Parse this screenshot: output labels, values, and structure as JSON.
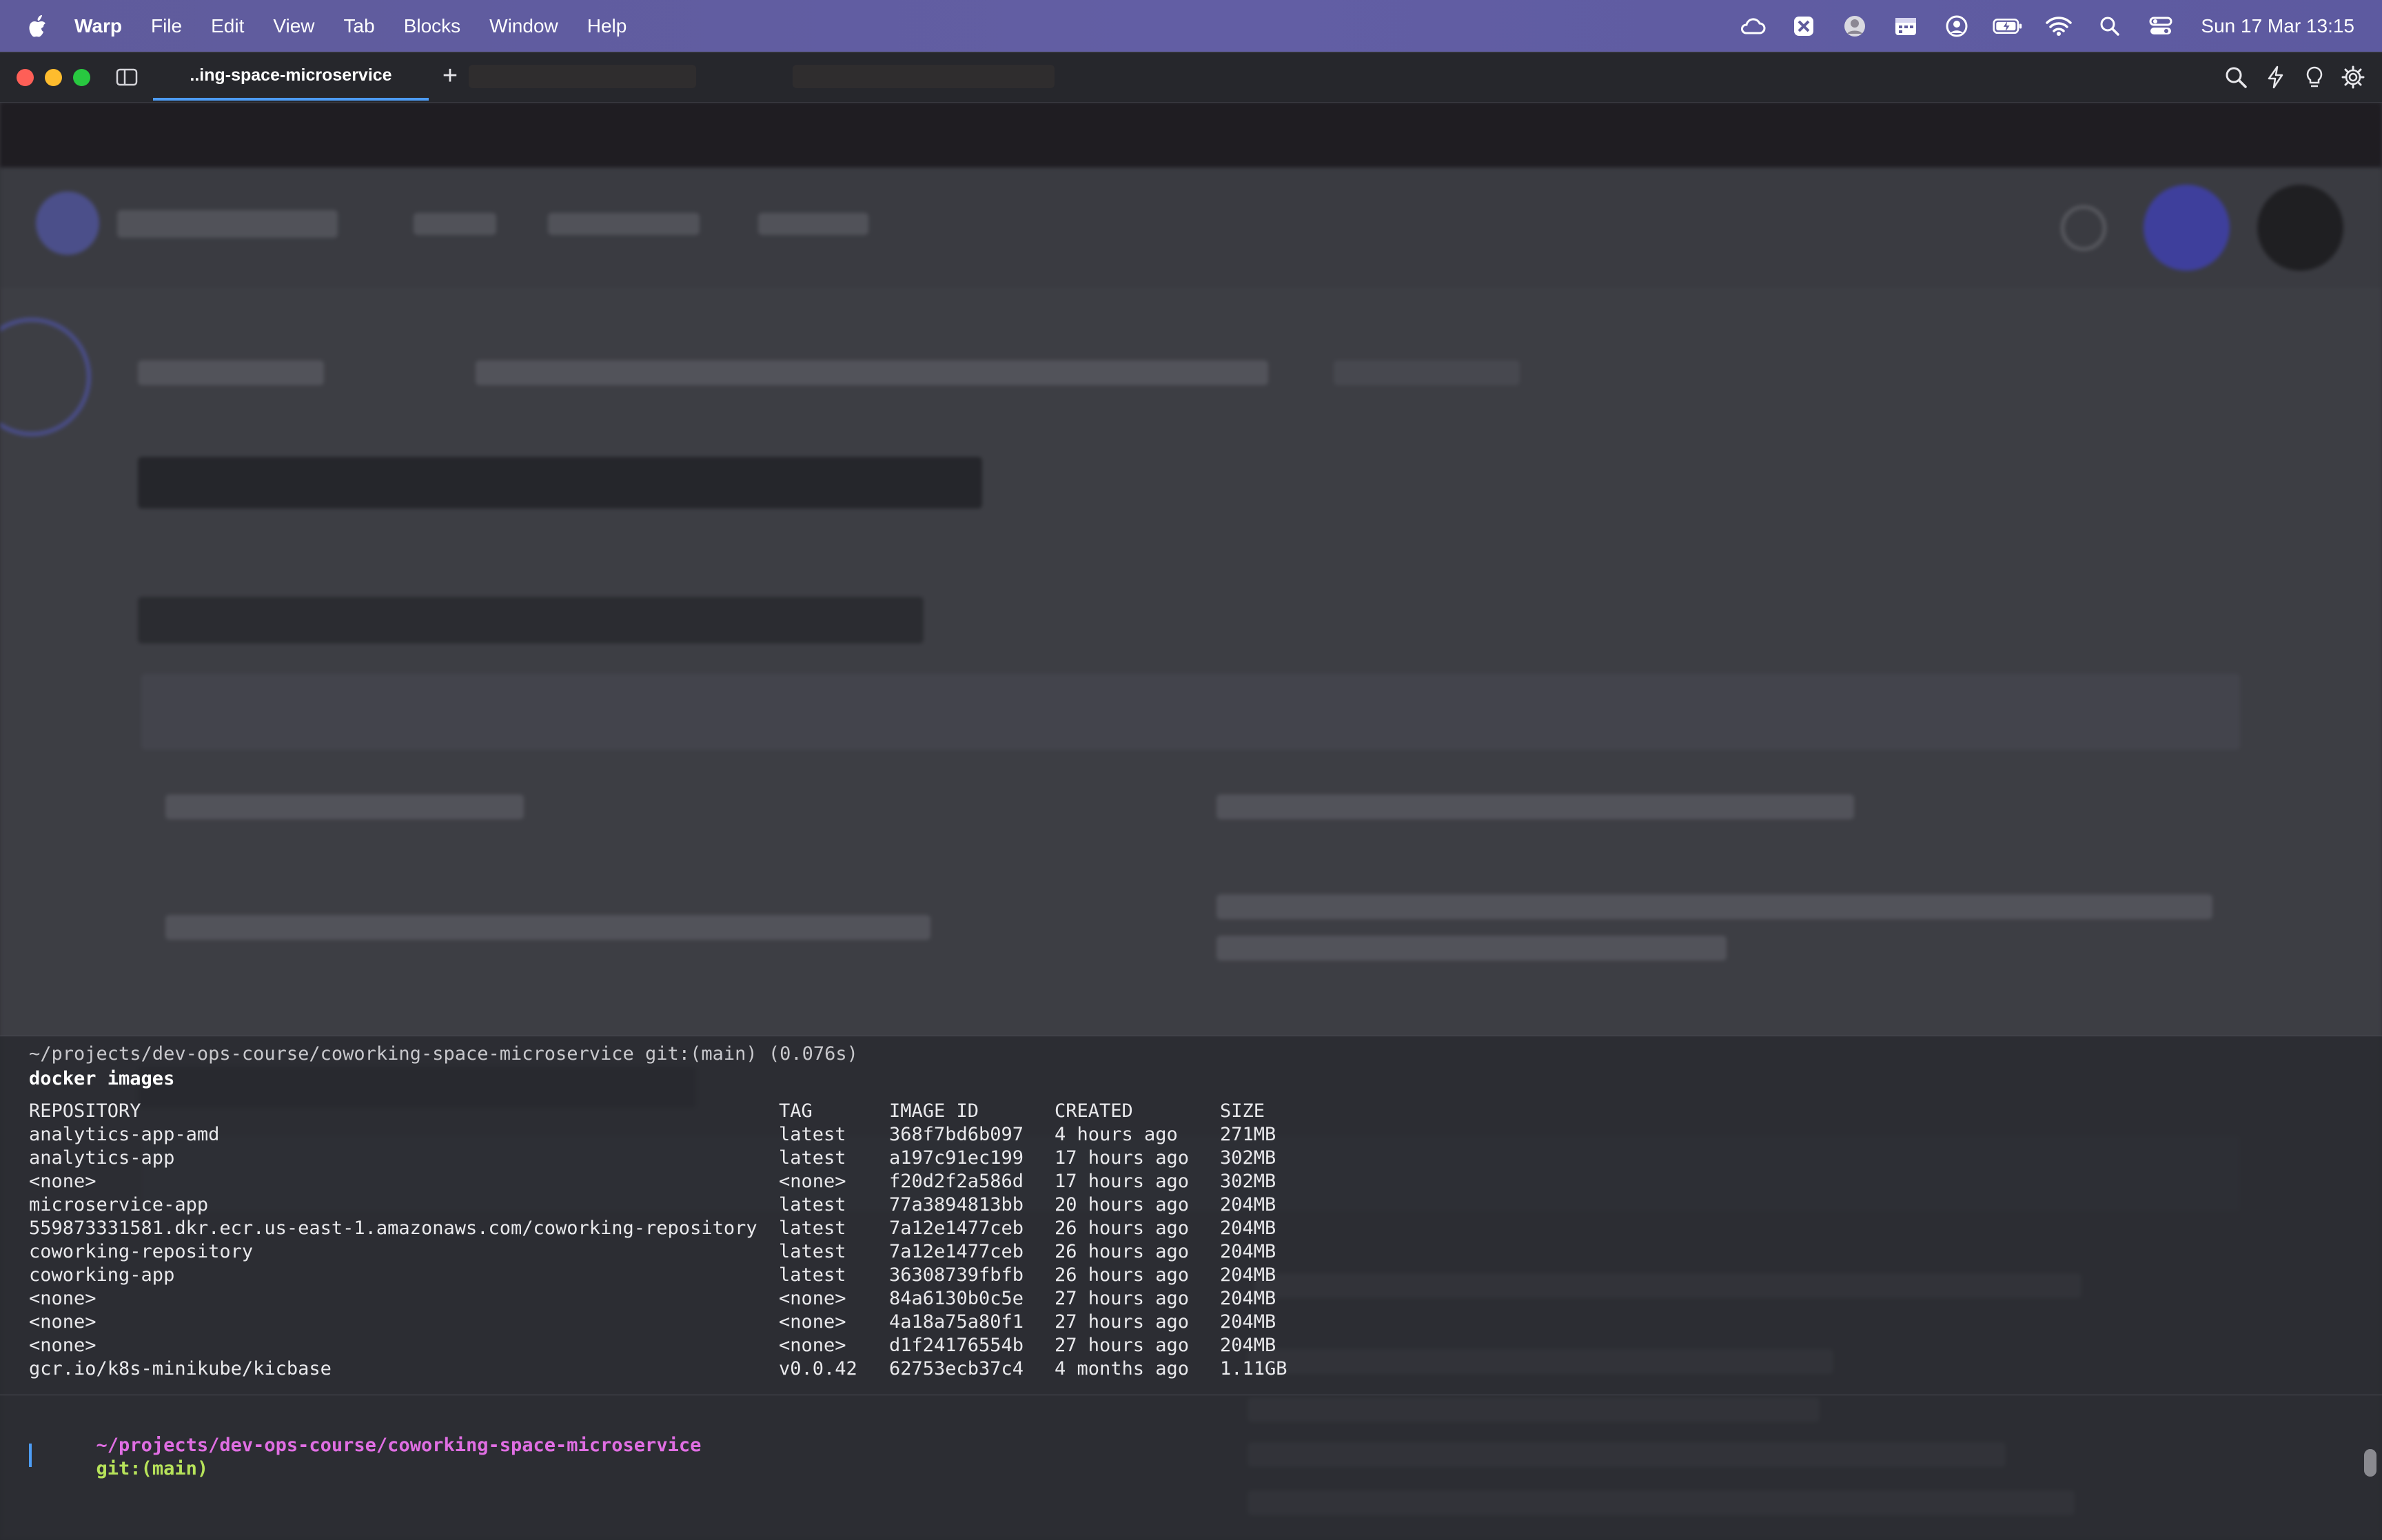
{
  "menubar": {
    "app_name": "Warp",
    "items": [
      "File",
      "Edit",
      "View",
      "Tab",
      "Blocks",
      "Window",
      "Help"
    ],
    "clock": "Sun 17 Mar  13:15",
    "status_icons": [
      "cloud-icon",
      "app-icon",
      "avatar-icon",
      "calendar-icon",
      "user-circle-icon",
      "battery-icon",
      "wifi-icon",
      "spotlight-icon",
      "control-center-icon"
    ]
  },
  "tabbar": {
    "active_tab": "..ing-space-microservice",
    "new_tab_glyph": "+"
  },
  "terminal": {
    "prev_prompt": "~/projects/dev-ops-course/coworking-space-microservice git:(main) (0.076s)",
    "command": "docker images",
    "headers": {
      "repository": "REPOSITORY",
      "tag": "TAG",
      "image_id": "IMAGE ID",
      "created": "CREATED",
      "size": "SIZE"
    },
    "rows": [
      {
        "repository": "analytics-app-amd",
        "tag": "latest",
        "image_id": "368f7bd6b097",
        "created": "4 hours ago",
        "size": "271MB"
      },
      {
        "repository": "analytics-app",
        "tag": "latest",
        "image_id": "a197c91ec199",
        "created": "17 hours ago",
        "size": "302MB"
      },
      {
        "repository": "<none>",
        "tag": "<none>",
        "image_id": "f20d2f2a586d",
        "created": "17 hours ago",
        "size": "302MB"
      },
      {
        "repository": "microservice-app",
        "tag": "latest",
        "image_id": "77a3894813bb",
        "created": "20 hours ago",
        "size": "204MB"
      },
      {
        "repository": "559873331581.dkr.ecr.us-east-1.amazonaws.com/coworking-repository",
        "tag": "latest",
        "image_id": "7a12e1477ceb",
        "created": "26 hours ago",
        "size": "204MB"
      },
      {
        "repository": "coworking-repository",
        "tag": "latest",
        "image_id": "7a12e1477ceb",
        "created": "26 hours ago",
        "size": "204MB"
      },
      {
        "repository": "coworking-app",
        "tag": "latest",
        "image_id": "36308739fbfb",
        "created": "26 hours ago",
        "size": "204MB"
      },
      {
        "repository": "<none>",
        "tag": "<none>",
        "image_id": "84a6130b0c5e",
        "created": "27 hours ago",
        "size": "204MB"
      },
      {
        "repository": "<none>",
        "tag": "<none>",
        "image_id": "4a18a75a80f1",
        "created": "27 hours ago",
        "size": "204MB"
      },
      {
        "repository": "<none>",
        "tag": "<none>",
        "image_id": "d1f24176554b",
        "created": "27 hours ago",
        "size": "204MB"
      },
      {
        "repository": "gcr.io/k8s-minikube/kicbase",
        "tag": "v0.0.42",
        "image_id": "62753ecb37c4",
        "created": "4 months ago",
        "size": "1.11GB"
      }
    ],
    "prompt_path": "~/projects/dev-ops-course/coworking-space-microservice",
    "prompt_git": "git:(main)"
  },
  "colors": {
    "menubar": "#625ea4",
    "prompt_path": "#e06ee3",
    "prompt_git": "#b7e35a",
    "accent": "#4d9cf5"
  }
}
